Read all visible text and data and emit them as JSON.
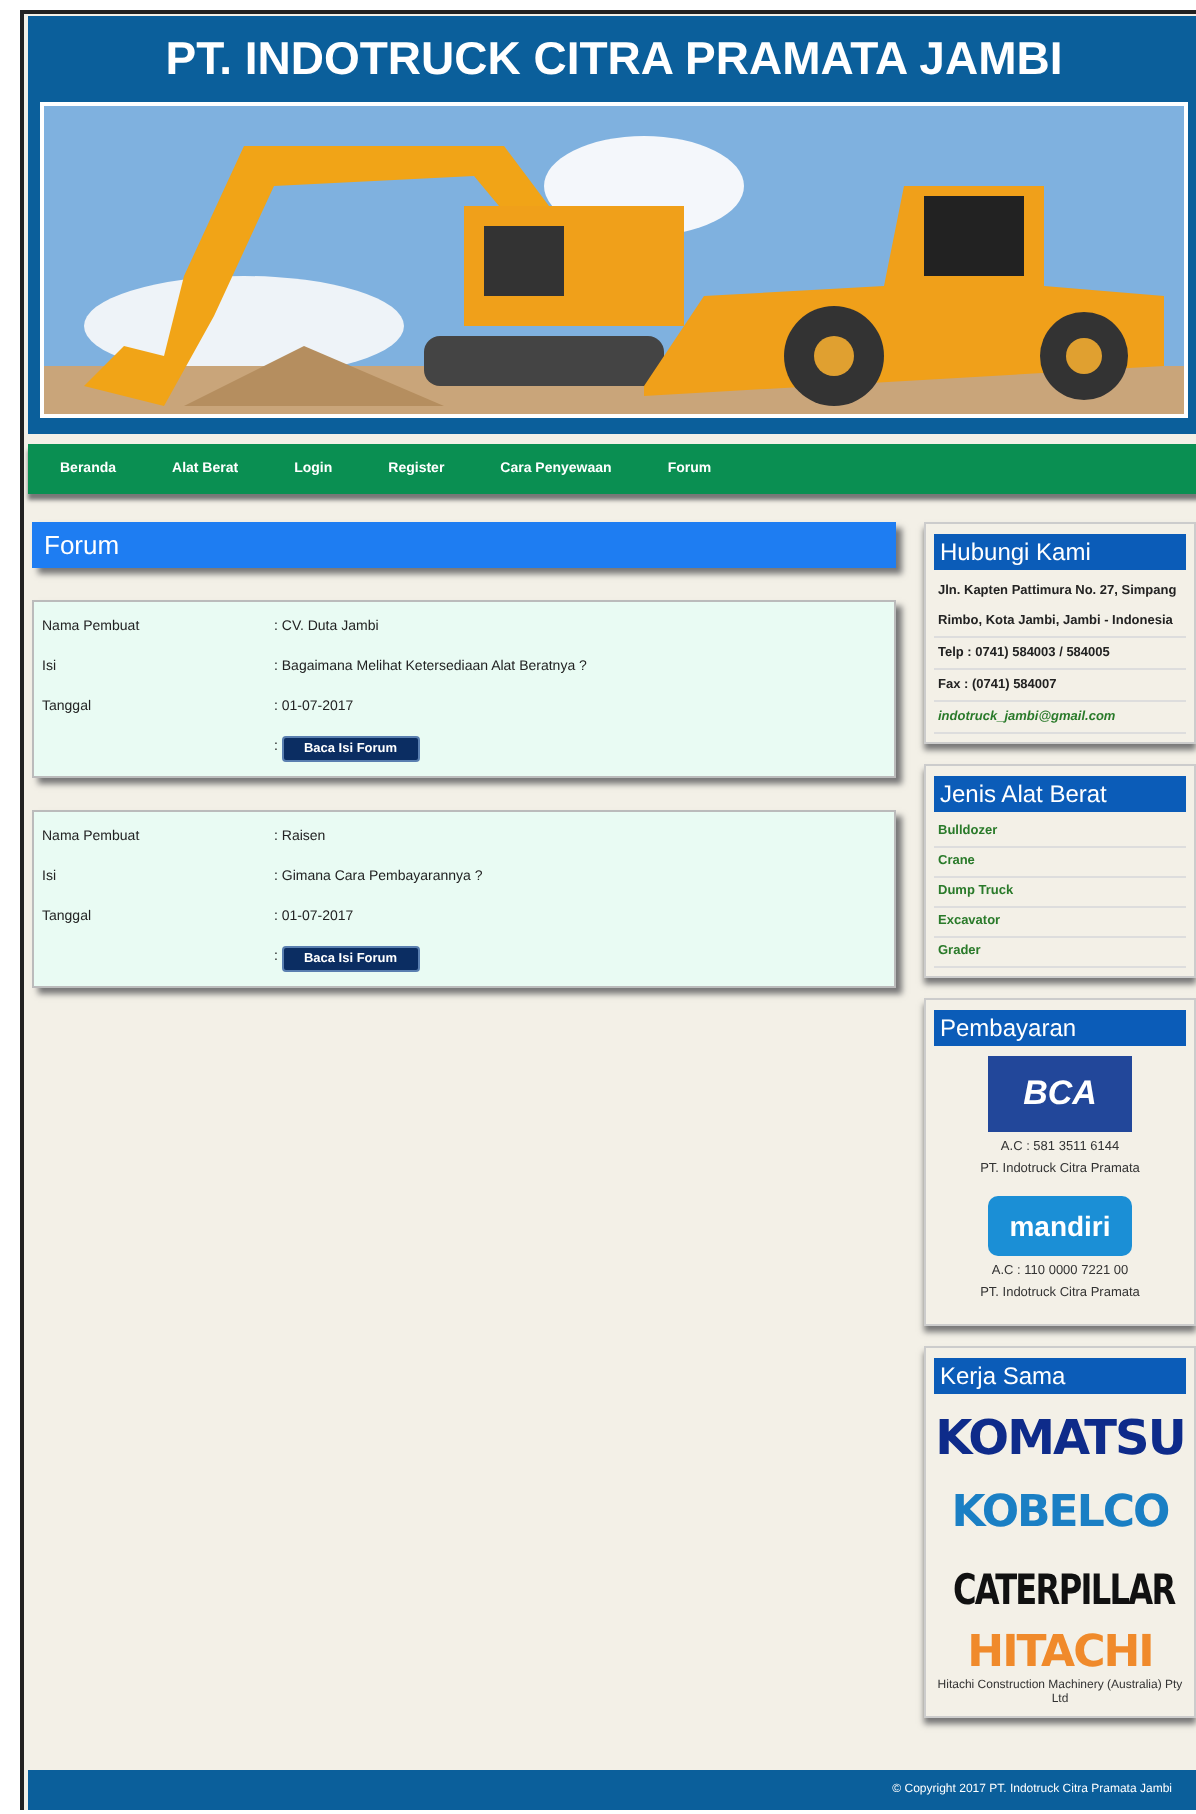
{
  "header": {
    "title": "PT. INDOTRUCK CITRA PRAMATA JAMBI"
  },
  "nav": [
    {
      "label": "Beranda"
    },
    {
      "label": "Alat Berat"
    },
    {
      "label": "Login"
    },
    {
      "label": "Register"
    },
    {
      "label": "Cara Penyewaan"
    },
    {
      "label": "Forum"
    }
  ],
  "main": {
    "title": "Forum",
    "posts": [
      {
        "fields": [
          {
            "label": "Nama Pembuat",
            "value": ": CV. Duta Jambi"
          },
          {
            "label": "Isi",
            "value": ": Bagaimana Melihat Ketersediaan Alat Beratnya ?"
          },
          {
            "label": "Tanggal",
            "value": ": 01-07-2017"
          }
        ],
        "button_prefix": ":",
        "button": "Baca Isi Forum"
      },
      {
        "fields": [
          {
            "label": "Nama Pembuat",
            "value": ": Raisen"
          },
          {
            "label": "Isi",
            "value": ": Gimana Cara Pembayarannya ?"
          },
          {
            "label": "Tanggal",
            "value": ": 01-07-2017"
          }
        ],
        "button_prefix": ":",
        "button": "Baca Isi Forum"
      }
    ]
  },
  "contact": {
    "title": "Hubungi Kami",
    "lines": [
      {
        "kind": "text",
        "text": "Jln. Kapten Pattimura No. 27, Simpang Rimbo, Kota Jambi, Jambi - Indonesia"
      },
      {
        "kind": "text",
        "text": "Telp : 0741) 584003 / 584005"
      },
      {
        "kind": "text",
        "text": "Fax : (0741) 584007"
      },
      {
        "kind": "email",
        "text": "indotruck_jambi@gmail.com"
      }
    ]
  },
  "equipment": {
    "title": "Jenis Alat Berat",
    "items": [
      {
        "label": "Bulldozer"
      },
      {
        "label": "Crane"
      },
      {
        "label": "Dump Truck"
      },
      {
        "label": "Excavator"
      },
      {
        "label": "Grader"
      }
    ]
  },
  "payment": {
    "title": "Pembayaran",
    "banks": [
      {
        "kind": "bca",
        "logo": "BCA",
        "account": "A.C : 581 3511 6144",
        "holder": "PT. Indotruck Citra Pramata"
      },
      {
        "kind": "mandiri",
        "logo": "mandiri",
        "account": "A.C : 110 0000 7221 00",
        "holder": "PT. Indotruck Citra Pramata"
      }
    ]
  },
  "partners": {
    "title": "Kerja Sama",
    "logos": [
      {
        "kind": "komatsu",
        "text": "KOMATSU"
      },
      {
        "kind": "kobelco",
        "text": "KOBELCO"
      },
      {
        "kind": "caterpillar",
        "text": "CATERPILLAR"
      },
      {
        "kind": "hitachi",
        "text": "HITACHI",
        "subtext": "Hitachi Construction Machinery (Australia) Pty Ltd"
      }
    ]
  },
  "footer": {
    "text": "© Copyright 2017 PT. Indotruck Citra Pramata Jambi"
  }
}
